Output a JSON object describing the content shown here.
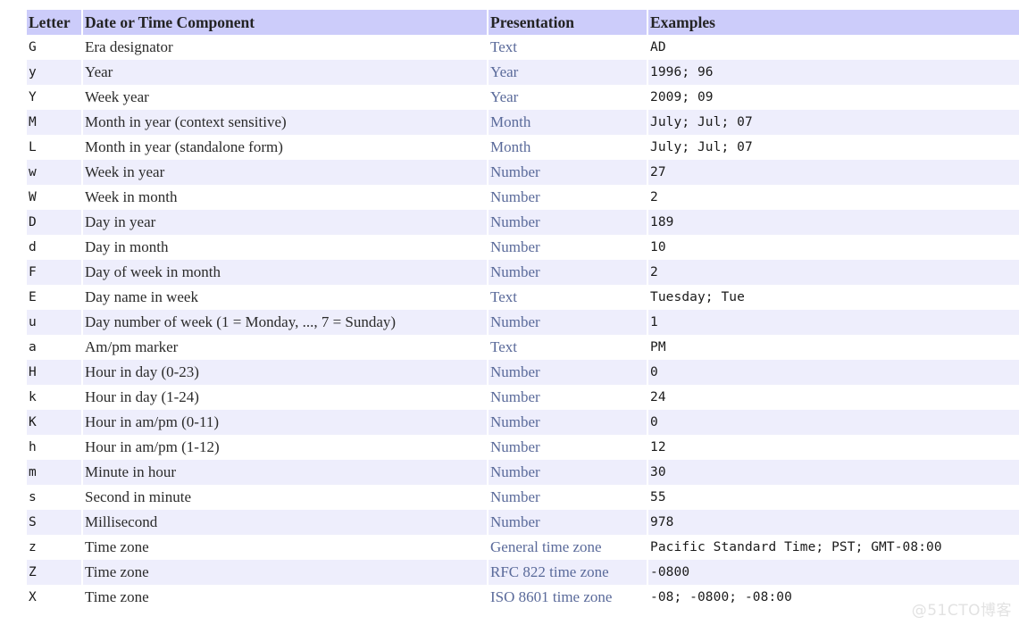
{
  "table": {
    "columns": [
      {
        "key": "letter",
        "label": "Letter"
      },
      {
        "key": "component",
        "label": "Date or Time Component"
      },
      {
        "key": "presentation",
        "label": "Presentation"
      },
      {
        "key": "examples",
        "label": "Examples"
      }
    ],
    "rows": [
      {
        "letter": "G",
        "component": "Era designator",
        "presentation": "Text",
        "examples": "AD"
      },
      {
        "letter": "y",
        "component": "Year",
        "presentation": "Year",
        "examples": "1996; 96"
      },
      {
        "letter": "Y",
        "component": "Week year",
        "presentation": "Year",
        "examples": "2009; 09"
      },
      {
        "letter": "M",
        "component": "Month in year (context sensitive)",
        "presentation": "Month",
        "examples": "July; Jul; 07"
      },
      {
        "letter": "L",
        "component": "Month in year (standalone form)",
        "presentation": "Month",
        "examples": "July; Jul; 07"
      },
      {
        "letter": "w",
        "component": "Week in year",
        "presentation": "Number",
        "examples": "27"
      },
      {
        "letter": "W",
        "component": "Week in month",
        "presentation": "Number",
        "examples": "2"
      },
      {
        "letter": "D",
        "component": "Day in year",
        "presentation": "Number",
        "examples": "189"
      },
      {
        "letter": "d",
        "component": "Day in month",
        "presentation": "Number",
        "examples": "10"
      },
      {
        "letter": "F",
        "component": "Day of week in month",
        "presentation": "Number",
        "examples": "2"
      },
      {
        "letter": "E",
        "component": "Day name in week",
        "presentation": "Text",
        "examples": "Tuesday; Tue"
      },
      {
        "letter": "u",
        "component": "Day number of week (1 = Monday, ..., 7 = Sunday)",
        "presentation": "Number",
        "examples": "1"
      },
      {
        "letter": "a",
        "component": "Am/pm marker",
        "presentation": "Text",
        "examples": "PM"
      },
      {
        "letter": "H",
        "component": "Hour in day (0-23)",
        "presentation": "Number",
        "examples": "0"
      },
      {
        "letter": "k",
        "component": "Hour in day (1-24)",
        "presentation": "Number",
        "examples": "24"
      },
      {
        "letter": "K",
        "component": "Hour in am/pm (0-11)",
        "presentation": "Number",
        "examples": "0"
      },
      {
        "letter": "h",
        "component": "Hour in am/pm (1-12)",
        "presentation": "Number",
        "examples": "12"
      },
      {
        "letter": "m",
        "component": "Minute in hour",
        "presentation": "Number",
        "examples": "30"
      },
      {
        "letter": "s",
        "component": "Second in minute",
        "presentation": "Number",
        "examples": "55"
      },
      {
        "letter": "S",
        "component": "Millisecond",
        "presentation": "Number",
        "examples": "978"
      },
      {
        "letter": "z",
        "component": "Time zone",
        "presentation": "General time zone",
        "examples": "Pacific Standard Time; PST; GMT-08:00"
      },
      {
        "letter": "Z",
        "component": "Time zone",
        "presentation": "RFC 822 time zone",
        "examples": "-0800"
      },
      {
        "letter": "X",
        "component": "Time zone",
        "presentation": "ISO 8601 time zone",
        "examples": "-08; -0800; -08:00"
      }
    ]
  },
  "watermark": {
    "text": "@51CTO博客"
  },
  "colors": {
    "header_background": "#ccccfa",
    "row_alt_background": "#eeeefc",
    "row_background": "#ffffff",
    "presentation_text": "#5a6a9a",
    "body_text": "#1a1a1a",
    "watermark_text": "#e2e2e2"
  }
}
